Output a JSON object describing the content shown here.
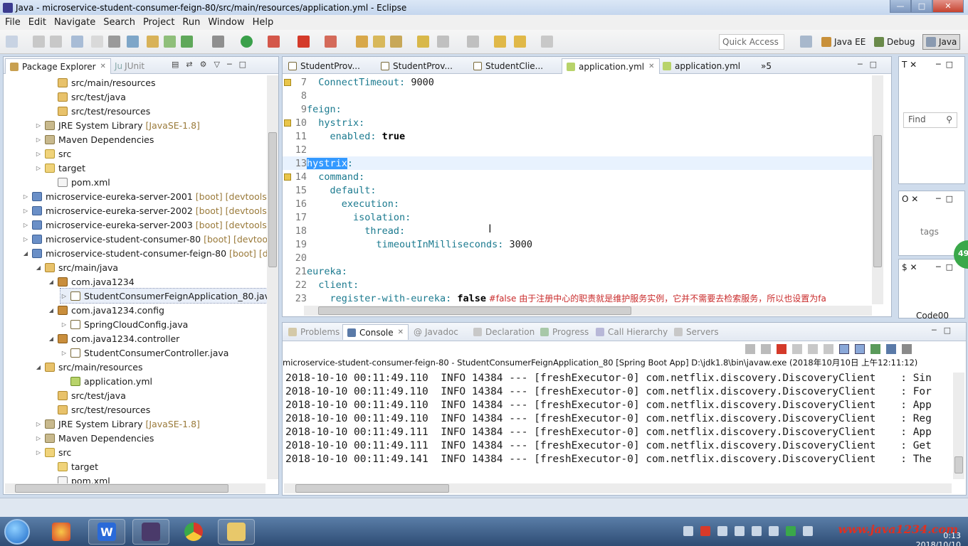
{
  "window": {
    "title": "Java - microservice-student-consumer-feign-80/src/main/resources/application.yml - Eclipse"
  },
  "menu": [
    "File",
    "Edit",
    "Navigate",
    "Search",
    "Project",
    "Run",
    "Window",
    "Help"
  ],
  "toolbar": {
    "quick_access_placeholder": "Quick Access",
    "perspectives": [
      "Java EE",
      "Debug",
      "Java"
    ]
  },
  "package_explorer": {
    "tabs": [
      "Package Explorer",
      "JUnit"
    ],
    "rows": [
      {
        "twisty": "",
        "icon": "pkgfolder",
        "label": "src/main/resources",
        "deco": "",
        "indent": 3
      },
      {
        "twisty": "",
        "icon": "pkgfolder",
        "label": "src/test/java",
        "deco": "",
        "indent": 3
      },
      {
        "twisty": "",
        "icon": "pkgfolder",
        "label": "src/test/resources",
        "deco": "",
        "indent": 3
      },
      {
        "twisty": "▷",
        "icon": "lib",
        "label": "JRE System Library",
        "deco": "[JavaSE-1.8]",
        "indent": 2
      },
      {
        "twisty": "▷",
        "icon": "lib",
        "label": "Maven Dependencies",
        "deco": "",
        "indent": 2
      },
      {
        "twisty": "▷",
        "icon": "folder",
        "label": "src",
        "deco": "",
        "indent": 2
      },
      {
        "twisty": "▷",
        "icon": "folder",
        "label": "target",
        "deco": "",
        "indent": 2
      },
      {
        "twisty": "",
        "icon": "file",
        "label": "pom.xml",
        "deco": "",
        "indent": 3
      },
      {
        "twisty": "▷",
        "icon": "proj",
        "label": "microservice-eureka-server-2001",
        "deco": "[boot] [devtools]",
        "indent": 1
      },
      {
        "twisty": "▷",
        "icon": "proj",
        "label": "microservice-eureka-server-2002",
        "deco": "[boot] [devtools]",
        "indent": 1
      },
      {
        "twisty": "▷",
        "icon": "proj",
        "label": "microservice-eureka-server-2003",
        "deco": "[boot] [devtools]",
        "indent": 1
      },
      {
        "twisty": "▷",
        "icon": "proj",
        "label": "microservice-student-consumer-80",
        "deco": "[boot] [devtools]",
        "indent": 1
      },
      {
        "twisty": "◢",
        "icon": "proj",
        "label": "microservice-student-consumer-feign-80",
        "deco": "[boot] [dev",
        "indent": 1
      },
      {
        "twisty": "◢",
        "icon": "pkgfolder",
        "label": "src/main/java",
        "deco": "",
        "indent": 2
      },
      {
        "twisty": "◢",
        "icon": "pkg",
        "label": "com.java1234",
        "deco": "",
        "indent": 3
      },
      {
        "twisty": "▷",
        "icon": "java",
        "label": "StudentConsumerFeignApplication_80.java",
        "deco": "",
        "indent": 4,
        "selected": true
      },
      {
        "twisty": "◢",
        "icon": "pkg",
        "label": "com.java1234.config",
        "deco": "",
        "indent": 3
      },
      {
        "twisty": "▷",
        "icon": "java",
        "label": "SpringCloudConfig.java",
        "deco": "",
        "indent": 4
      },
      {
        "twisty": "◢",
        "icon": "pkg",
        "label": "com.java1234.controller",
        "deco": "",
        "indent": 3
      },
      {
        "twisty": "▷",
        "icon": "java",
        "label": "StudentConsumerController.java",
        "deco": "",
        "indent": 4
      },
      {
        "twisty": "◢",
        "icon": "pkgfolder",
        "label": "src/main/resources",
        "deco": "",
        "indent": 2
      },
      {
        "twisty": "",
        "icon": "yml",
        "label": "application.yml",
        "deco": "",
        "indent": 4
      },
      {
        "twisty": "",
        "icon": "pkgfolder",
        "label": "src/test/java",
        "deco": "",
        "indent": 3
      },
      {
        "twisty": "",
        "icon": "pkgfolder",
        "label": "src/test/resources",
        "deco": "",
        "indent": 3
      },
      {
        "twisty": "▷",
        "icon": "lib",
        "label": "JRE System Library",
        "deco": "[JavaSE-1.8]",
        "indent": 2
      },
      {
        "twisty": "▷",
        "icon": "lib",
        "label": "Maven Dependencies",
        "deco": "",
        "indent": 2
      },
      {
        "twisty": "▷",
        "icon": "folder",
        "label": "src",
        "deco": "",
        "indent": 2
      },
      {
        "twisty": "",
        "icon": "folder",
        "label": "target",
        "deco": "",
        "indent": 3
      },
      {
        "twisty": "",
        "icon": "file",
        "label": "pom.xml",
        "deco": "",
        "indent": 3
      }
    ]
  },
  "editor": {
    "tabs": [
      "StudentProv...",
      "StudentProv...",
      "StudentClie...",
      "application.yml",
      "application.yml"
    ],
    "overflow": "»5",
    "lines": [
      {
        "n": "7",
        "indent": "  ",
        "key": "ConnectTimeout:",
        "val": " 9000",
        "marker": true
      },
      {
        "n": "8",
        "indent": "",
        "key": "",
        "val": ""
      },
      {
        "n": "9",
        "indent": "",
        "key": "feign:",
        "val": ""
      },
      {
        "n": "10",
        "indent": "  ",
        "key": "hystrix:",
        "val": "",
        "marker": true
      },
      {
        "n": "11",
        "indent": "    ",
        "key": "enabled:",
        "val": " true",
        "bold": true
      },
      {
        "n": "12",
        "indent": "",
        "key": "",
        "val": ""
      },
      {
        "n": "13",
        "indent": "",
        "key": "hystrix",
        "val": ":",
        "sel": true,
        "hl": true
      },
      {
        "n": "14",
        "indent": "  ",
        "key": "command:",
        "val": "",
        "marker": true
      },
      {
        "n": "15",
        "indent": "    ",
        "key": "default:",
        "val": ""
      },
      {
        "n": "16",
        "indent": "      ",
        "key": "execution:",
        "val": ""
      },
      {
        "n": "17",
        "indent": "        ",
        "key": "isolation:",
        "val": ""
      },
      {
        "n": "18",
        "indent": "          ",
        "key": "thread:",
        "val": ""
      },
      {
        "n": "19",
        "indent": "            ",
        "key": "timeoutInMilliseconds:",
        "val": " 3000"
      },
      {
        "n": "20",
        "indent": "",
        "key": "",
        "val": ""
      },
      {
        "n": "21",
        "indent": "",
        "key": "eureka:",
        "val": ""
      },
      {
        "n": "22",
        "indent": "  ",
        "key": "client:",
        "val": ""
      },
      {
        "n": "23",
        "indent": "    ",
        "key": "register-with-eureka:",
        "val": " false",
        "bold": true,
        "comment": " #false 由于注册中心的职责就是维护服务实例，它并不需要去检索服务，所以也设置为fa"
      }
    ]
  },
  "bottom": {
    "tabs": [
      "Problems",
      "Console",
      "Javadoc",
      "Declaration",
      "Progress",
      "Call Hierarchy",
      "Servers"
    ],
    "console_header": "microservice-student-consumer-feign-80 - StudentConsumerFeignApplication_80 [Spring Boot App] D:\\jdk1.8\\bin\\javaw.exe (2018年10月10日 上午12:11:12)",
    "lines": [
      "2018-10-10 00:11:49.110  INFO 14384 --- [freshExecutor-0] com.netflix.discovery.DiscoveryClient    : Sin",
      "2018-10-10 00:11:49.110  INFO 14384 --- [freshExecutor-0] com.netflix.discovery.DiscoveryClient    : For",
      "2018-10-10 00:11:49.110  INFO 14384 --- [freshExecutor-0] com.netflix.discovery.DiscoveryClient    : App",
      "2018-10-10 00:11:49.110  INFO 14384 --- [freshExecutor-0] com.netflix.discovery.DiscoveryClient    : Reg",
      "2018-10-10 00:11:49.111  INFO 14384 --- [freshExecutor-0] com.netflix.discovery.DiscoveryClient    : App",
      "2018-10-10 00:11:49.111  INFO 14384 --- [freshExecutor-0] com.netflix.discovery.DiscoveryClient    : Get",
      "2018-10-10 00:11:49.141  INFO 14384 --- [freshExecutor-0] com.netflix.discovery.DiscoveryClient    : The"
    ]
  },
  "right_panels": {
    "find_placeholder": "Find",
    "outline_item": "tags",
    "code_item": "Code00",
    "badge": "49"
  },
  "taskbar": {
    "time": "0:13",
    "date": "2018/10/10",
    "watermark": "www.java1234.com"
  },
  "colors": {
    "yaml_key": "#1b7a8f",
    "comment": "#c92a2a",
    "selection": "#3399ff"
  }
}
